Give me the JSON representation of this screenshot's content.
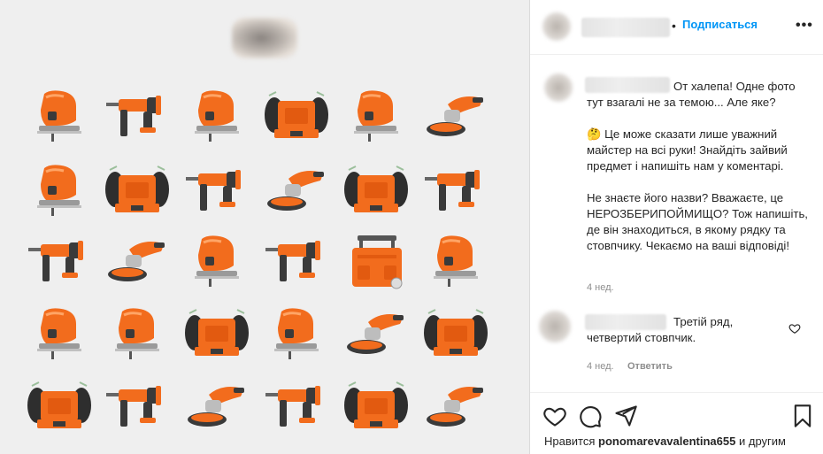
{
  "post": {
    "header": {
      "follow_label": "Подписаться",
      "dot": "•",
      "more_label": "•••"
    },
    "image": {
      "rows": [
        [
          "jigsaw",
          "rotary-hammer",
          "jigsaw",
          "bench-grinder",
          "jigsaw",
          "angle-grinder"
        ],
        [
          "jigsaw",
          "bench-grinder",
          "rotary-hammer",
          "angle-grinder",
          "bench-grinder",
          "rotary-hammer"
        ],
        [
          "rotary-hammer",
          "angle-grinder",
          "jigsaw",
          "rotary-hammer",
          "tool-box",
          "jigsaw"
        ],
        [
          "jigsaw",
          "jigsaw",
          "bench-grinder",
          "jigsaw",
          "angle-grinder",
          "bench-grinder"
        ],
        [
          "bench-grinder",
          "rotary-hammer",
          "angle-grinder",
          "rotary-hammer",
          "bench-grinder",
          "angle-grinder"
        ]
      ],
      "accent_color": "#f26c1d",
      "dark_color": "#3a3a3a"
    },
    "caption": {
      "line1": "От халепа! Одне фото тут взагалі не за темою... Але яке?",
      "paragraph2": "🤔 Це може сказати лише уважний майстер на всі руки! Знайдіть зайвий предмет і напишіть нам у коментарі.",
      "paragraph3": "Не знаєте його назви? Вважаєте, це НЕРОЗБЕРИПОЙМИЩО? Тож напишіть, де він знаходиться, в якому рядку та стовпчику. Чекаємо на ваші відповіді!",
      "time": "4 нед."
    },
    "comment": {
      "text": "Третій ряд, четвертий стовпчик.",
      "time": "4 нед.",
      "reply_label": "Ответить"
    },
    "likes": {
      "prefix": "Нравится",
      "user": "ponomarevavalentina655",
      "suffix": "и другим"
    },
    "colors": {
      "link_blue": "#0095f6",
      "muted": "#8e8e8e",
      "text": "#262626"
    }
  }
}
